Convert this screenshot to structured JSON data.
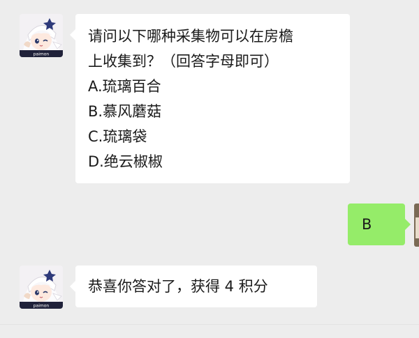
{
  "messages": [
    {
      "sender": "bot",
      "avatar": "paimon-avatar",
      "lines": [
        "请问以下哪种采集物可以在房檐",
        "上收集到？（回答字母即可）",
        "A.琉璃百合",
        "B.慕风蘑菇",
        "C.琉璃袋",
        "D.绝云椒椒"
      ]
    },
    {
      "sender": "self",
      "text": "B"
    },
    {
      "sender": "bot",
      "avatar": "paimon-avatar",
      "text": "恭喜你答对了，获得 4 积分"
    }
  ],
  "colors": {
    "background": "#ededed",
    "incoming_bubble": "#ffffff",
    "outgoing_bubble": "#95ec69"
  },
  "avatar_badge": "paimon"
}
